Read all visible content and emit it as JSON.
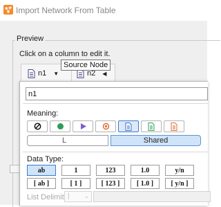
{
  "window": {
    "title": "Import Network From Table",
    "icon": "cytoscape-app-icon"
  },
  "preview": {
    "legend": "Preview",
    "hint": "Click on a column to edit it.",
    "columns": [
      {
        "name": "n1",
        "icon": "document-icon",
        "dropdown": "▼"
      },
      {
        "name": "n2",
        "icon": "document-icon",
        "dropdown": "◀"
      }
    ]
  },
  "editor": {
    "name_value": "n1",
    "meaning_label": "Meaning:",
    "meaning_buttons": [
      {
        "name": "skip-icon",
        "selected": false,
        "color": "#111111"
      },
      {
        "name": "source-node-icon",
        "selected": false,
        "color": "#2e9e55"
      },
      {
        "name": "target-node-icon",
        "selected": false,
        "color": "#7f5fc4"
      },
      {
        "name": "interaction-icon",
        "selected": false,
        "color": "#e06a2a"
      },
      {
        "name": "source-attribute-icon",
        "selected": true,
        "color": "#3a6fc4"
      },
      {
        "name": "edge-attribute-icon",
        "selected": false,
        "color": "#2e9e55"
      },
      {
        "name": "target-attribute-icon",
        "selected": false,
        "color": "#e06a2a"
      }
    ],
    "scope_left": "L",
    "scope_right": "Shared",
    "tooltip": "Source Node",
    "data_type_label": "Data Type:",
    "types_row1": [
      "ab",
      "1",
      "123",
      "1.0",
      "y/n"
    ],
    "types_row2": [
      "[ ab ]",
      "[ 1 ]",
      "[ 123 ]",
      "[ 1.0 ]",
      "[ y/n ]"
    ],
    "selected_type": "ab",
    "list_delimiter_label": "List Delimiter:",
    "list_delimiter_value": "|"
  },
  "colors": {
    "accent": "#3a7ad1",
    "selected_bg": "#cfe4f8",
    "dialog_bg": "#efefef"
  }
}
